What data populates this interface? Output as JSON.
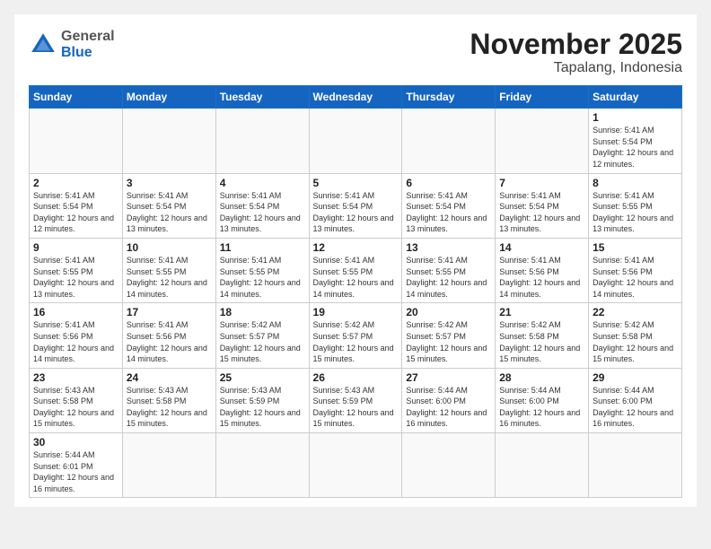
{
  "header": {
    "logo_general": "General",
    "logo_blue": "Blue",
    "month": "November 2025",
    "location": "Tapalang, Indonesia"
  },
  "weekdays": [
    "Sunday",
    "Monday",
    "Tuesday",
    "Wednesday",
    "Thursday",
    "Friday",
    "Saturday"
  ],
  "days": {
    "1": {
      "sunrise": "5:41 AM",
      "sunset": "5:54 PM",
      "daylight": "12 hours and 12 minutes."
    },
    "2": {
      "sunrise": "5:41 AM",
      "sunset": "5:54 PM",
      "daylight": "12 hours and 12 minutes."
    },
    "3": {
      "sunrise": "5:41 AM",
      "sunset": "5:54 PM",
      "daylight": "12 hours and 13 minutes."
    },
    "4": {
      "sunrise": "5:41 AM",
      "sunset": "5:54 PM",
      "daylight": "12 hours and 13 minutes."
    },
    "5": {
      "sunrise": "5:41 AM",
      "sunset": "5:54 PM",
      "daylight": "12 hours and 13 minutes."
    },
    "6": {
      "sunrise": "5:41 AM",
      "sunset": "5:54 PM",
      "daylight": "12 hours and 13 minutes."
    },
    "7": {
      "sunrise": "5:41 AM",
      "sunset": "5:54 PM",
      "daylight": "12 hours and 13 minutes."
    },
    "8": {
      "sunrise": "5:41 AM",
      "sunset": "5:55 PM",
      "daylight": "12 hours and 13 minutes."
    },
    "9": {
      "sunrise": "5:41 AM",
      "sunset": "5:55 PM",
      "daylight": "12 hours and 13 minutes."
    },
    "10": {
      "sunrise": "5:41 AM",
      "sunset": "5:55 PM",
      "daylight": "12 hours and 14 minutes."
    },
    "11": {
      "sunrise": "5:41 AM",
      "sunset": "5:55 PM",
      "daylight": "12 hours and 14 minutes."
    },
    "12": {
      "sunrise": "5:41 AM",
      "sunset": "5:55 PM",
      "daylight": "12 hours and 14 minutes."
    },
    "13": {
      "sunrise": "5:41 AM",
      "sunset": "5:55 PM",
      "daylight": "12 hours and 14 minutes."
    },
    "14": {
      "sunrise": "5:41 AM",
      "sunset": "5:56 PM",
      "daylight": "12 hours and 14 minutes."
    },
    "15": {
      "sunrise": "5:41 AM",
      "sunset": "5:56 PM",
      "daylight": "12 hours and 14 minutes."
    },
    "16": {
      "sunrise": "5:41 AM",
      "sunset": "5:56 PM",
      "daylight": "12 hours and 14 minutes."
    },
    "17": {
      "sunrise": "5:41 AM",
      "sunset": "5:56 PM",
      "daylight": "12 hours and 14 minutes."
    },
    "18": {
      "sunrise": "5:42 AM",
      "sunset": "5:57 PM",
      "daylight": "12 hours and 15 minutes."
    },
    "19": {
      "sunrise": "5:42 AM",
      "sunset": "5:57 PM",
      "daylight": "12 hours and 15 minutes."
    },
    "20": {
      "sunrise": "5:42 AM",
      "sunset": "5:57 PM",
      "daylight": "12 hours and 15 minutes."
    },
    "21": {
      "sunrise": "5:42 AM",
      "sunset": "5:58 PM",
      "daylight": "12 hours and 15 minutes."
    },
    "22": {
      "sunrise": "5:42 AM",
      "sunset": "5:58 PM",
      "daylight": "12 hours and 15 minutes."
    },
    "23": {
      "sunrise": "5:43 AM",
      "sunset": "5:58 PM",
      "daylight": "12 hours and 15 minutes."
    },
    "24": {
      "sunrise": "5:43 AM",
      "sunset": "5:58 PM",
      "daylight": "12 hours and 15 minutes."
    },
    "25": {
      "sunrise": "5:43 AM",
      "sunset": "5:59 PM",
      "daylight": "12 hours and 15 minutes."
    },
    "26": {
      "sunrise": "5:43 AM",
      "sunset": "5:59 PM",
      "daylight": "12 hours and 15 minutes."
    },
    "27": {
      "sunrise": "5:44 AM",
      "sunset": "6:00 PM",
      "daylight": "12 hours and 16 minutes."
    },
    "28": {
      "sunrise": "5:44 AM",
      "sunset": "6:00 PM",
      "daylight": "12 hours and 16 minutes."
    },
    "29": {
      "sunrise": "5:44 AM",
      "sunset": "6:00 PM",
      "daylight": "12 hours and 16 minutes."
    },
    "30": {
      "sunrise": "5:44 AM",
      "sunset": "6:01 PM",
      "daylight": "12 hours and 16 minutes."
    }
  },
  "labels": {
    "sunrise": "Sunrise:",
    "sunset": "Sunset:",
    "daylight": "Daylight:"
  }
}
